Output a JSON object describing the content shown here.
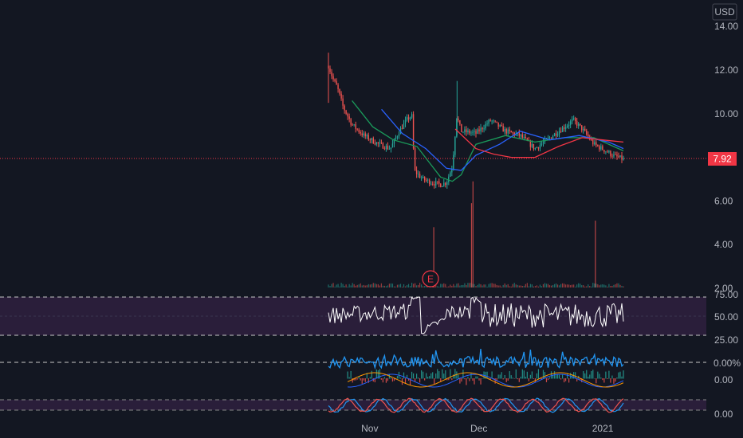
{
  "currency": "USD",
  "chart_data": {
    "type": "candlestick",
    "price_axis": {
      "ticks": [
        "14.00",
        "12.00",
        "10.00",
        "8.00",
        "6.00",
        "4.00",
        "2.00"
      ],
      "range": [
        2.0,
        14.0
      ]
    },
    "last_price": {
      "label": "7.92",
      "value": 7.92,
      "color": "#f23645"
    },
    "earnings_marker": {
      "label": "E",
      "x": 0.355,
      "color": "#f23645"
    },
    "time_axis": [
      {
        "label": "Nov",
        "x": 0.14
      },
      {
        "label": "Dec",
        "x": 0.51
      },
      {
        "label": "2021",
        "x": 0.93
      }
    ],
    "price_keyframes": [
      [
        0.0,
        12.2
      ],
      [
        0.015,
        11.6
      ],
      [
        0.03,
        11.2
      ],
      [
        0.05,
        10.3
      ],
      [
        0.08,
        9.5
      ],
      [
        0.12,
        9.0
      ],
      [
        0.17,
        8.6
      ],
      [
        0.21,
        8.4
      ],
      [
        0.24,
        9.2
      ],
      [
        0.27,
        9.8
      ],
      [
        0.285,
        9.9
      ],
      [
        0.29,
        7.4
      ],
      [
        0.32,
        7.0
      ],
      [
        0.35,
        6.85
      ],
      [
        0.38,
        6.75
      ],
      [
        0.4,
        6.85
      ],
      [
        0.42,
        7.6
      ],
      [
        0.435,
        9.9
      ],
      [
        0.45,
        9.2
      ],
      [
        0.5,
        9.1
      ],
      [
        0.55,
        9.7
      ],
      [
        0.6,
        9.2
      ],
      [
        0.65,
        9.0
      ],
      [
        0.7,
        8.4
      ],
      [
        0.75,
        8.9
      ],
      [
        0.8,
        9.4
      ],
      [
        0.83,
        9.7
      ],
      [
        0.86,
        9.3
      ],
      [
        0.9,
        8.6
      ],
      [
        0.94,
        8.3
      ],
      [
        0.97,
        8.05
      ],
      [
        1.0,
        7.92
      ]
    ],
    "moving_averages": [
      {
        "color": "#1a9a5a",
        "points": [
          [
            0.08,
            10.6
          ],
          [
            0.15,
            9.4
          ],
          [
            0.22,
            8.8
          ],
          [
            0.3,
            8.5
          ],
          [
            0.34,
            7.8
          ],
          [
            0.38,
            7.1
          ],
          [
            0.42,
            6.9
          ],
          [
            0.45,
            7.2
          ],
          [
            0.5,
            8.6
          ],
          [
            0.6,
            9.0
          ],
          [
            0.7,
            8.7
          ],
          [
            0.8,
            8.9
          ],
          [
            0.9,
            8.9
          ],
          [
            1.0,
            8.3
          ]
        ]
      },
      {
        "color": "#2962ff",
        "points": [
          [
            0.18,
            10.2
          ],
          [
            0.25,
            9.1
          ],
          [
            0.33,
            8.4
          ],
          [
            0.4,
            7.5
          ],
          [
            0.45,
            7.4
          ],
          [
            0.5,
            8.1
          ],
          [
            0.58,
            8.6
          ],
          [
            0.65,
            9.2
          ],
          [
            0.75,
            8.8
          ],
          [
            0.85,
            9.0
          ],
          [
            0.95,
            8.7
          ],
          [
            1.0,
            8.4
          ]
        ]
      },
      {
        "color": "#f23645",
        "points": [
          [
            0.43,
            9.3
          ],
          [
            0.5,
            8.4
          ],
          [
            0.56,
            8.15
          ],
          [
            0.62,
            8.0
          ],
          [
            0.7,
            8.0
          ],
          [
            0.78,
            8.5
          ],
          [
            0.86,
            8.9
          ],
          [
            0.93,
            8.8
          ],
          [
            1.0,
            8.7
          ]
        ]
      }
    ],
    "volume_spikes": [
      [
        0.357,
        2.8
      ],
      [
        0.485,
        3.9
      ],
      [
        0.49,
        4.9
      ],
      [
        0.905,
        3.1
      ]
    ],
    "rsi": {
      "levels": [
        75.0,
        50.0,
        25.0
      ],
      "labels": [
        "75.00",
        "50.00",
        "25.00"
      ],
      "band": [
        30,
        70
      ]
    },
    "percent_oscillator": {
      "label": "0.00%"
    },
    "histogram_oscillator": {
      "label": "0.00"
    },
    "stoch_oscillator": {
      "label": "0.00"
    }
  }
}
